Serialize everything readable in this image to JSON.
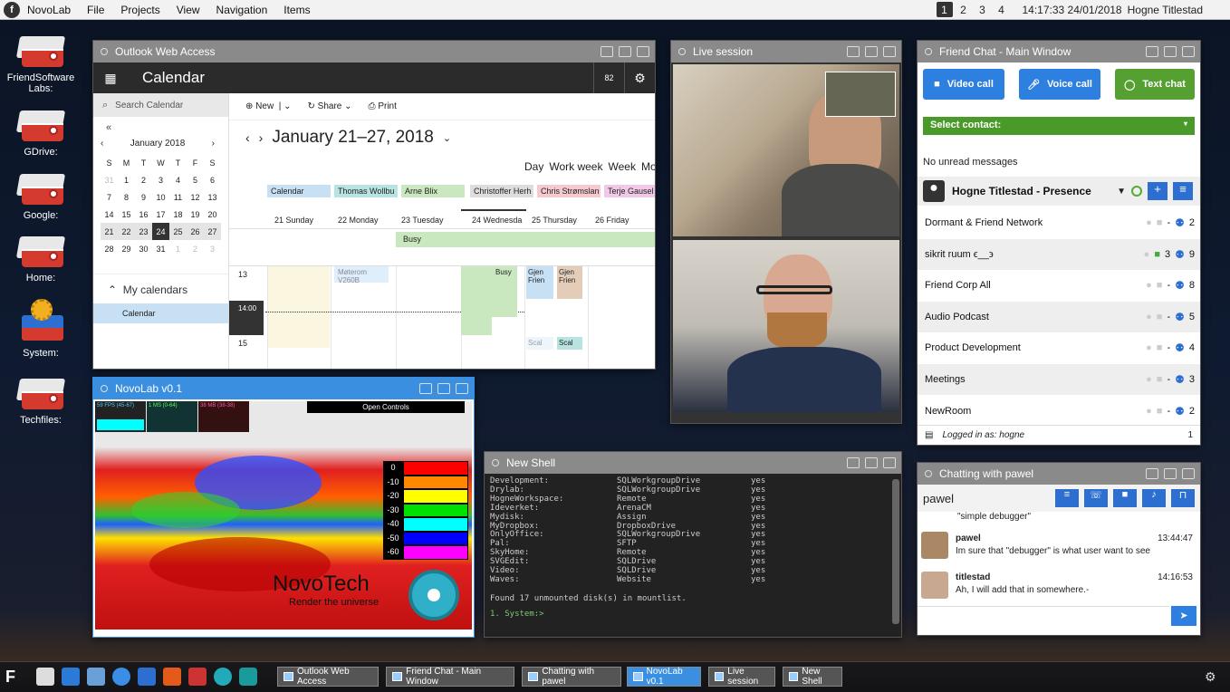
{
  "menubar": {
    "app": "NovoLab",
    "items": [
      "File",
      "Projects",
      "View",
      "Navigation",
      "Items"
    ],
    "workspaces": [
      "1",
      "2",
      "3",
      "4"
    ],
    "active_workspace": "1",
    "clock": "14:17:33 24/01/2018",
    "user": "Hogne Titlestad"
  },
  "desktop_icons": [
    "FriendSoftware Labs:",
    "GDrive:",
    "Google:",
    "Home:",
    "System:",
    "Techfiles:"
  ],
  "outlook": {
    "window_title": "Outlook Web Access",
    "app_title": "Calendar",
    "badge": "82",
    "search": "Search Calendar",
    "toolbar": {
      "new": "New",
      "share": "Share",
      "print": "Print"
    },
    "mini_month": "January 2018",
    "week_days": [
      "S",
      "M",
      "T",
      "W",
      "T",
      "F",
      "S"
    ],
    "weeks": [
      [
        "31",
        "1",
        "2",
        "3",
        "4",
        "5",
        "6"
      ],
      [
        "7",
        "8",
        "9",
        "10",
        "11",
        "12",
        "13"
      ],
      [
        "14",
        "15",
        "16",
        "17",
        "18",
        "19",
        "20"
      ],
      [
        "21",
        "22",
        "23",
        "24",
        "25",
        "26",
        "27"
      ],
      [
        "28",
        "29",
        "30",
        "31",
        "1",
        "2",
        "3"
      ]
    ],
    "my_calendars": "My calendars",
    "calendar_item": "Calendar",
    "range": "January 21–27, 2018",
    "views": [
      "Day",
      "Work week",
      "Week",
      "Mo"
    ],
    "chips": [
      "Calendar",
      "Thomas Wollbu",
      "Arne Blix",
      "Christoffer Herh",
      "Chris Strømslan",
      "Terje Gausel"
    ],
    "days": [
      "21 Sunday",
      "22 Monday",
      "23 Tuesday",
      "24 Wednesda",
      "25 Thursday",
      "26 Friday"
    ],
    "busy": "Busy",
    "hour13": "13",
    "now": "14:00",
    "hour15": "15",
    "ev_moterom": "Møterom",
    "ev_v260b": "V260B",
    "ev_busy2": "Busy",
    "ev_gjen1": "Gjen",
    "ev_frien1": "Frien",
    "ev_gjen2": "Gjen",
    "ev_frien2": "Frien",
    "ev_scal1": "Scal",
    "ev_scal2": "Scal"
  },
  "live": {
    "window_title": "Live session"
  },
  "friendchat": {
    "window_title": "Friend Chat - Main Window",
    "video": "Video call",
    "voice": "Voice call",
    "text": "Text chat",
    "select": "Select contact:",
    "unread": "No unread messages",
    "presence": "Hogne Titlestad - Presence",
    "rooms": [
      {
        "name": "Dormant & Friend Network",
        "users": "2"
      },
      {
        "name": "sikrit ruum ϵ__϶",
        "video": "3",
        "users": "9"
      },
      {
        "name": "Friend Corp All",
        "users": "8"
      },
      {
        "name": "Audio Podcast",
        "users": "5"
      },
      {
        "name": "Product Development",
        "users": "4"
      },
      {
        "name": "Meetings",
        "users": "3"
      },
      {
        "name": "NewRoom",
        "users": "2"
      }
    ],
    "logged": "Logged in as: hogne",
    "logged_count": "1",
    "dash": "-"
  },
  "chatwith": {
    "window_title": "Chatting with pawel",
    "name": "pawel",
    "prev": "\"simple debugger\"",
    "messages": [
      {
        "from": "pawel",
        "time": "13:44:47",
        "text": "Im sure that \"debugger\" is  what user want to see"
      },
      {
        "from": "titlestad",
        "time": "14:16:53",
        "text": "Ah, I will add that in somewhere.-"
      }
    ]
  },
  "novolab": {
    "window_title": "NovoLab v0.1",
    "fps": "59 FPS (45-67)",
    "ms": "1 MS (0-64)",
    "mb": "38 MB (38-38)",
    "controls": "Open Controls",
    "legend": [
      "0",
      "-10",
      "-20",
      "-30",
      "-40",
      "-50",
      "-60"
    ],
    "legend_colors": [
      "#ff0000",
      "#ff8800",
      "#ffff00",
      "#00e000",
      "#00ffff",
      "#0000ff",
      "#ff00ff"
    ],
    "brand": "NovoTech",
    "tagline": "Render the universe"
  },
  "shell": {
    "window_title": "New Shell",
    "lines": [
      [
        "Development:",
        "SQLWorkgroupDrive",
        "yes"
      ],
      [
        "Drylab:",
        "SQLWorkgroupDrive",
        "yes"
      ],
      [
        "HogneWorkspace:",
        "Remote",
        "yes"
      ],
      [
        "Ideverket:",
        "ArenaCM",
        "yes"
      ],
      [
        "Mydisk:",
        "Assign",
        "yes"
      ],
      [
        "MyDropbox:",
        "DropboxDrive",
        "yes"
      ],
      [
        "OnlyOffice:",
        "SQLWorkgroupDrive",
        "yes"
      ],
      [
        "Pal:",
        "SFTP",
        "yes"
      ],
      [
        "SkyHome:",
        "Remote",
        "yes"
      ],
      [
        "SVGEdit:",
        "SQLDrive",
        "yes"
      ],
      [
        "Video:",
        "SQLDrive",
        "yes"
      ],
      [
        "Waves:",
        "Website",
        "yes"
      ]
    ],
    "found": "Found 17 unmounted disk(s) in mountlist.",
    "prompt": "1. System:>"
  },
  "taskbar": [
    "Outlook Web Access",
    "Friend Chat - Main Window",
    "Chatting with pawel",
    "NovoLab v0.1",
    "Live session",
    "New Shell"
  ]
}
